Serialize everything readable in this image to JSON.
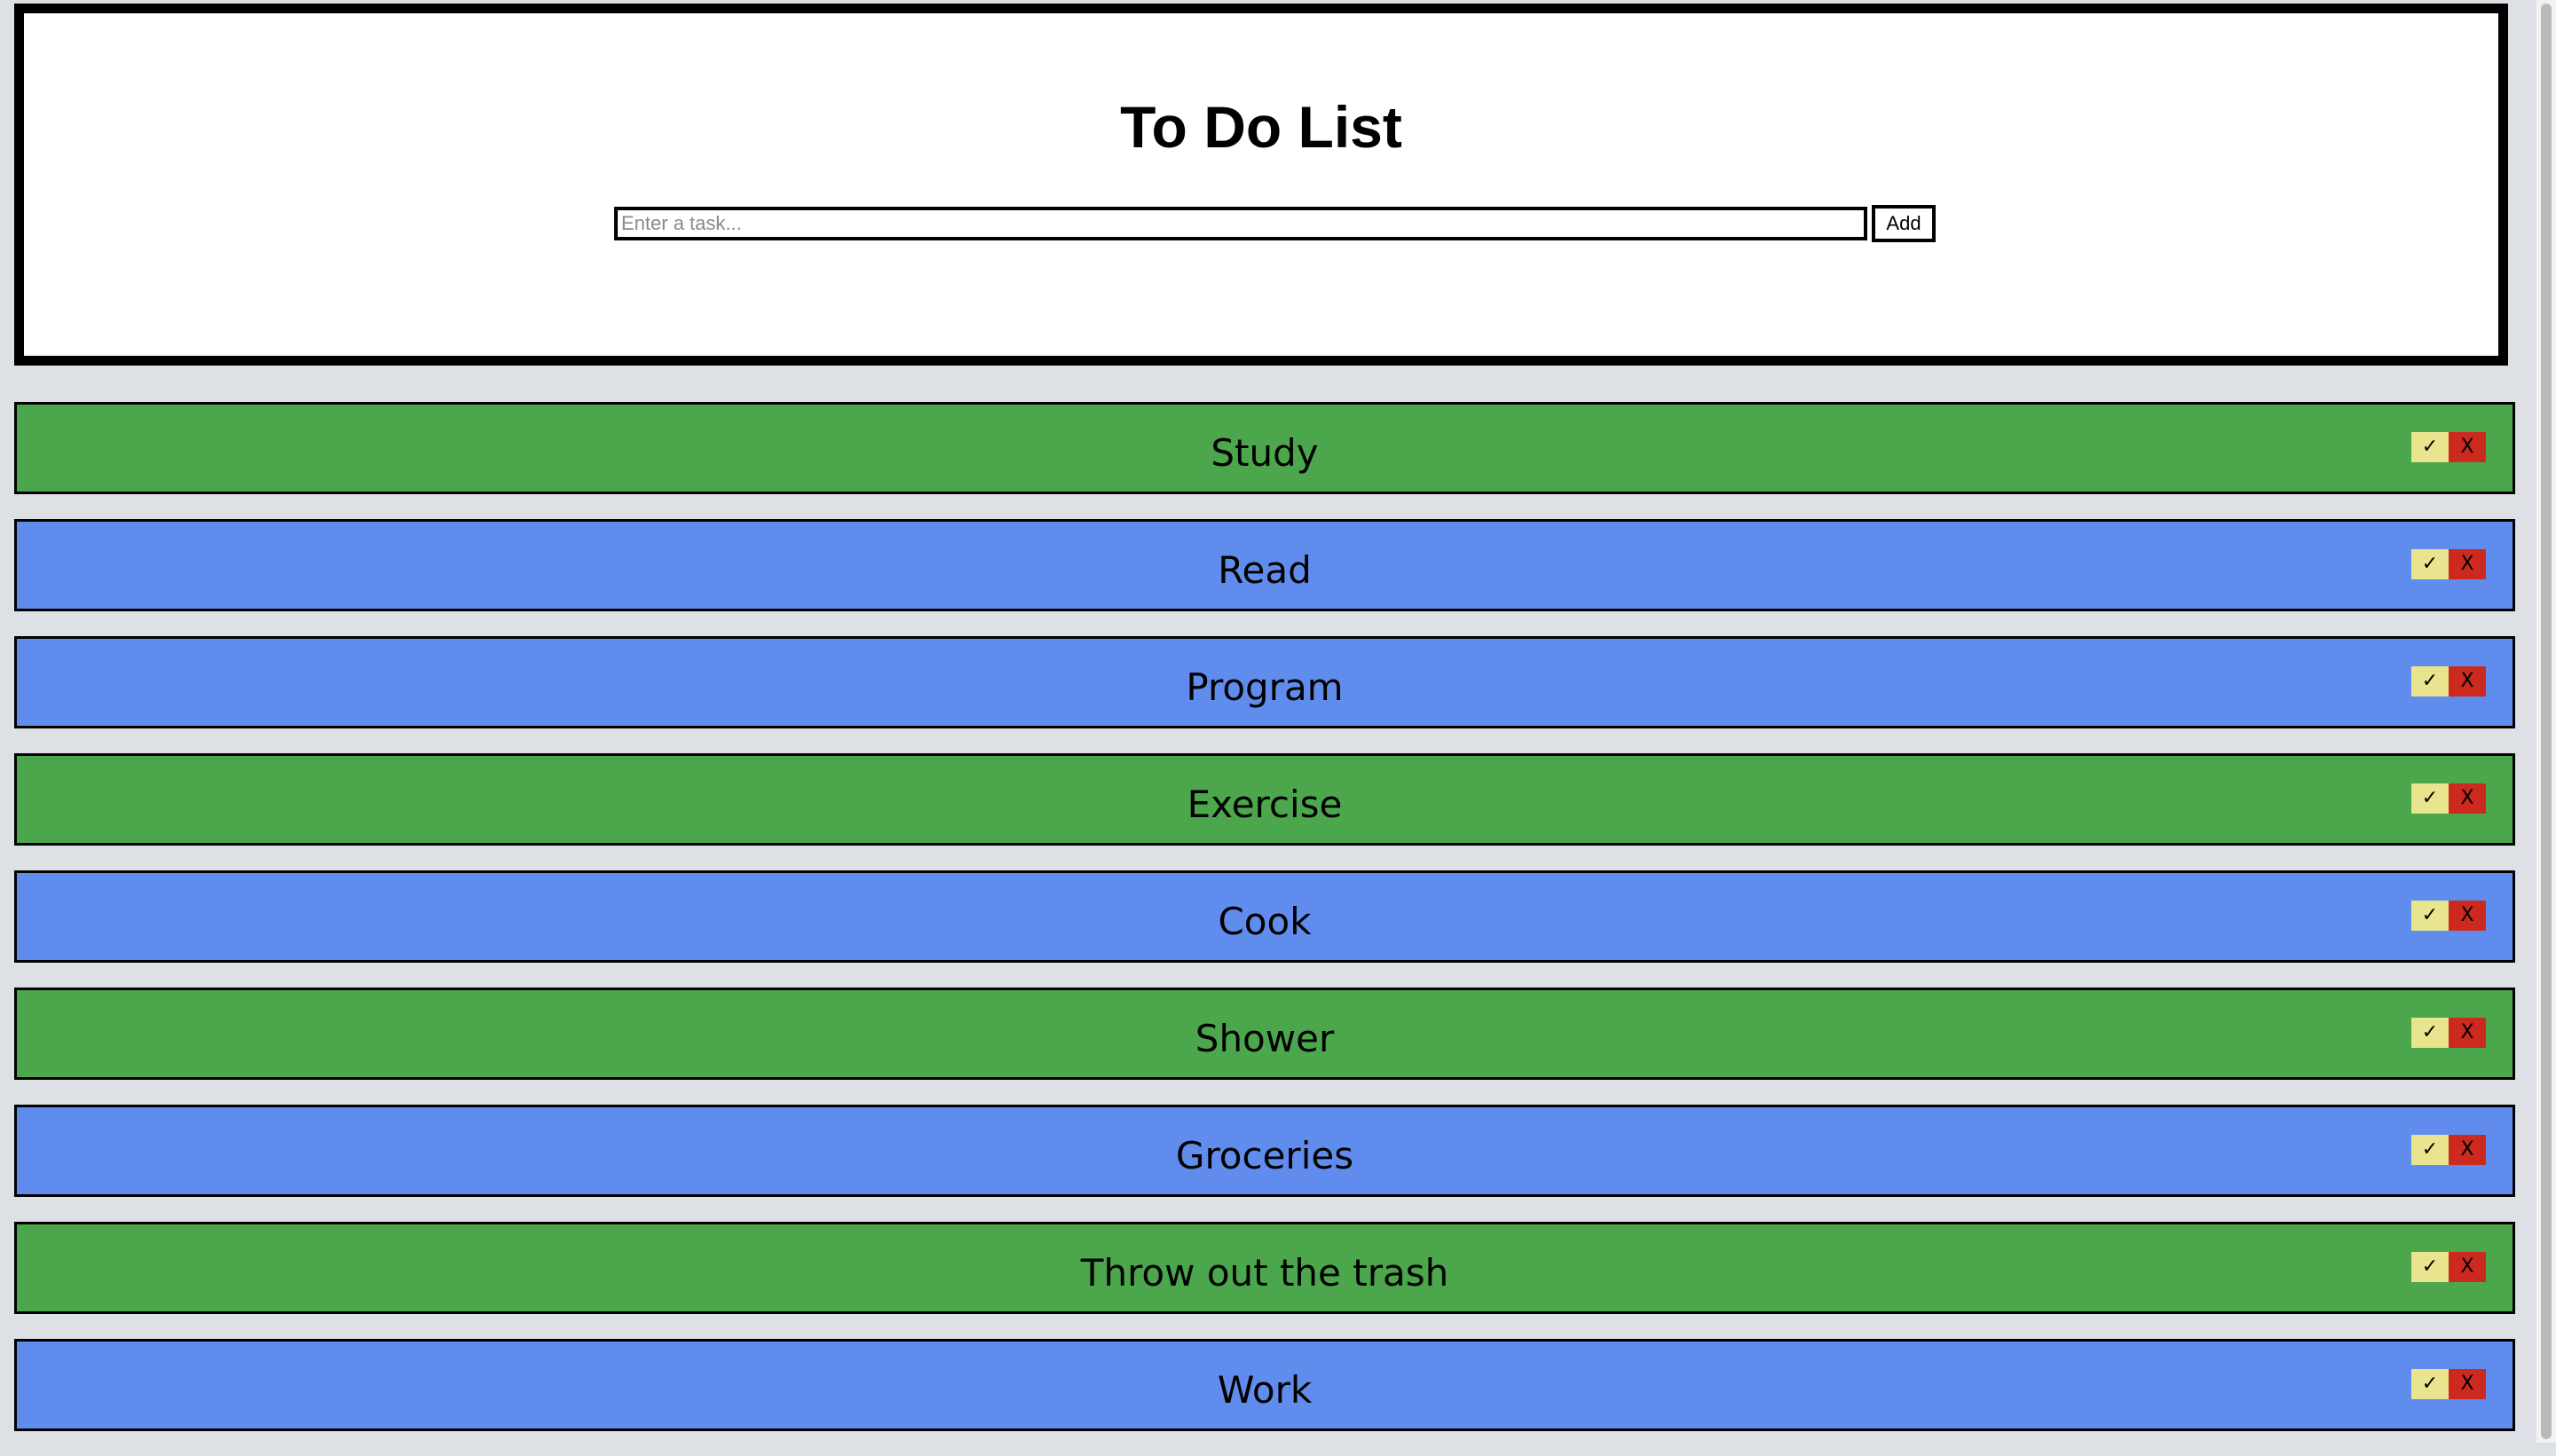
{
  "header": {
    "title": "To Do List",
    "input_placeholder": "Enter a task...",
    "input_value": "",
    "add_label": "Add"
  },
  "colors": {
    "completed": "#4ca64c",
    "pending": "#608ded",
    "check_button": "#e8e58e",
    "delete_button": "#cc2a1e"
  },
  "tasks": [
    {
      "label": "Study",
      "status": "completed",
      "check_label": "✓",
      "delete_label": "X"
    },
    {
      "label": "Read",
      "status": "pending",
      "check_label": "✓",
      "delete_label": "X"
    },
    {
      "label": "Program",
      "status": "pending",
      "check_label": "✓",
      "delete_label": "X"
    },
    {
      "label": "Exercise",
      "status": "completed",
      "check_label": "✓",
      "delete_label": "X"
    },
    {
      "label": "Cook",
      "status": "pending",
      "check_label": "✓",
      "delete_label": "X"
    },
    {
      "label": "Shower",
      "status": "completed",
      "check_label": "✓",
      "delete_label": "X"
    },
    {
      "label": "Groceries",
      "status": "pending",
      "check_label": "✓",
      "delete_label": "X"
    },
    {
      "label": "Throw out the trash",
      "status": "completed",
      "check_label": "✓",
      "delete_label": "X"
    },
    {
      "label": "Work",
      "status": "pending",
      "check_label": "✓",
      "delete_label": "X"
    }
  ]
}
